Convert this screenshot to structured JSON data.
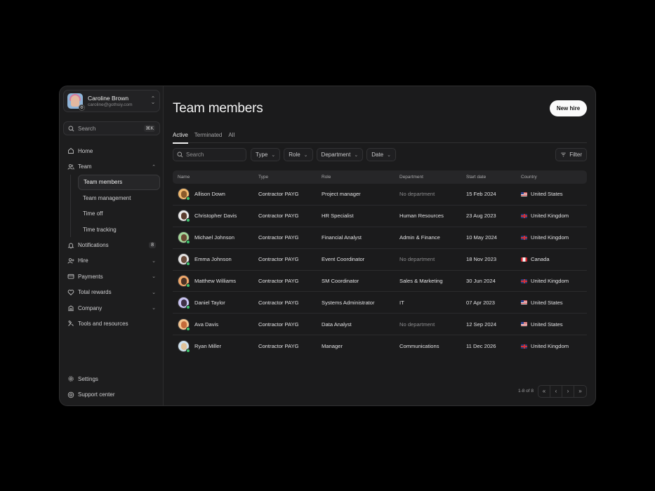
{
  "account": {
    "name": "Caroline Brown",
    "email": "caroline@gothsiy.com"
  },
  "sidebar": {
    "search_label": "Search",
    "search_shortcut": "⌘K",
    "items": [
      {
        "label": "Home",
        "icon": "home-icon"
      },
      {
        "label": "Team",
        "icon": "users-icon",
        "expandable": true
      },
      {
        "label": "Notifications",
        "icon": "bell-icon",
        "count": "8"
      },
      {
        "label": "Hire",
        "icon": "user-plus-icon",
        "expandable": true
      },
      {
        "label": "Payments",
        "icon": "credit-card-icon",
        "expandable": true
      },
      {
        "label": "Total rewards",
        "icon": "heart-icon",
        "expandable": true
      },
      {
        "label": "Company",
        "icon": "building-icon",
        "expandable": true
      },
      {
        "label": "Tools and resources",
        "icon": "tools-icon"
      }
    ],
    "team_sub": [
      {
        "label": "Team members",
        "active": true
      },
      {
        "label": "Team management"
      },
      {
        "label": "Time off"
      },
      {
        "label": "Time tracking"
      }
    ],
    "bottom": [
      {
        "label": "Settings",
        "icon": "gear-icon"
      },
      {
        "label": "Support center",
        "icon": "support-icon"
      }
    ]
  },
  "main": {
    "title": "Team members",
    "new_hire_label": "New hire",
    "tabs": [
      {
        "label": "Active",
        "active": true
      },
      {
        "label": "Terminated"
      },
      {
        "label": "All"
      }
    ],
    "filters": {
      "search_placeholder": "Search",
      "type": "Type",
      "role": "Role",
      "department": "Department",
      "date": "Date",
      "filter": "Filter"
    },
    "columns": [
      "Name",
      "Type",
      "Role",
      "Department",
      "Start date",
      "Country"
    ],
    "rows": [
      {
        "name": "Allison Down",
        "type": "Contractor PAYG",
        "role": "Project manager",
        "department": "No department",
        "start_date": "15 Feb 2024",
        "country": "United States",
        "flag": "us"
      },
      {
        "name": "Christopher Davis",
        "type": "Contractor PAYG",
        "role": "HR Specialist",
        "department": "Human Resources",
        "start_date": "23 Aug 2023",
        "country": "United Kingdom",
        "flag": "uk"
      },
      {
        "name": "Michael Johnson",
        "type": "Contractor PAYG",
        "role": "Financial Analyst",
        "department": "Admin & Finance",
        "start_date": "10 May 2024",
        "country": "United Kingdom",
        "flag": "uk"
      },
      {
        "name": "Emma Johnson",
        "type": "Contractor PAYG",
        "role": "Event Coordinator",
        "department": "No department",
        "start_date": "18 Nov 2023",
        "country": "Canada",
        "flag": "ca"
      },
      {
        "name": "Matthew Williams",
        "type": "Contractor PAYG",
        "role": "SM Coordinator",
        "department": "Sales & Marketing",
        "start_date": "30 Jun 2024",
        "country": "United Kingdom",
        "flag": "uk"
      },
      {
        "name": "Daniel Taylor",
        "type": "Contractor PAYG",
        "role": "Systems Administrator",
        "department": "IT",
        "start_date": "07 Apr 2023",
        "country": "United States",
        "flag": "us"
      },
      {
        "name": "Ava Davis",
        "type": "Contractor PAYG",
        "role": "Data Analyst",
        "department": "No department",
        "start_date": "12 Sep 2024",
        "country": "United States",
        "flag": "us"
      },
      {
        "name": "Ryan Miller",
        "type": "Contractor PAYG",
        "role": "Manager",
        "department": "Communications",
        "start_date": "11 Dec 2026",
        "country": "United Kingdom",
        "flag": "uk"
      }
    ],
    "pagination": "1-8 of 8"
  },
  "colors": {
    "background": "#000000",
    "panel": "#1b1b1c",
    "online": "#3ec46d",
    "accent_button": "#fafafa"
  }
}
